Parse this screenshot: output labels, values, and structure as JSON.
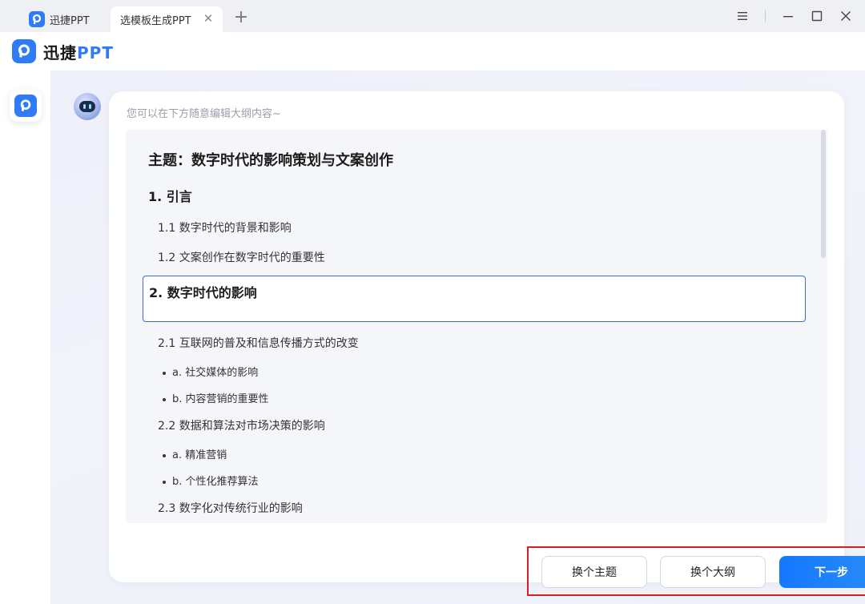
{
  "tabs": [
    {
      "label": "迅捷PPT"
    },
    {
      "label": "选模板生成PPT"
    }
  ],
  "brand": {
    "name_prefix": "迅捷",
    "name_accent": "PPT"
  },
  "hint": "您可以在下方随意编辑大纲内容~",
  "outline": {
    "title": "主题：数字时代的影响策划与文案创作",
    "sections": [
      {
        "label": "1. 引言"
      },
      {
        "label": "1.1  数字时代的背景和影响"
      },
      {
        "label": "1.2  文案创作在数字时代的重要性"
      },
      {
        "label": "2. 数字时代的影响"
      },
      {
        "label": "2.1  互联网的普及和信息传播方式的改变"
      },
      {
        "label": "a. 社交媒体的影响"
      },
      {
        "label": "b. 内容营销的重要性"
      },
      {
        "label": "2.2  数据和算法对市场决策的影响"
      },
      {
        "label": "a. 精准营销"
      },
      {
        "label": "b. 个性化推荐算法"
      },
      {
        "label": "2.3  数字化对传统行业的影响"
      }
    ]
  },
  "buttons": {
    "change_theme": "换个主题",
    "change_outline": "换个大纲",
    "next": "下一步"
  },
  "colors": {
    "accent": "#2f7cf6",
    "primary_button": "#1478ff",
    "highlight_border": "#d81e1e"
  }
}
